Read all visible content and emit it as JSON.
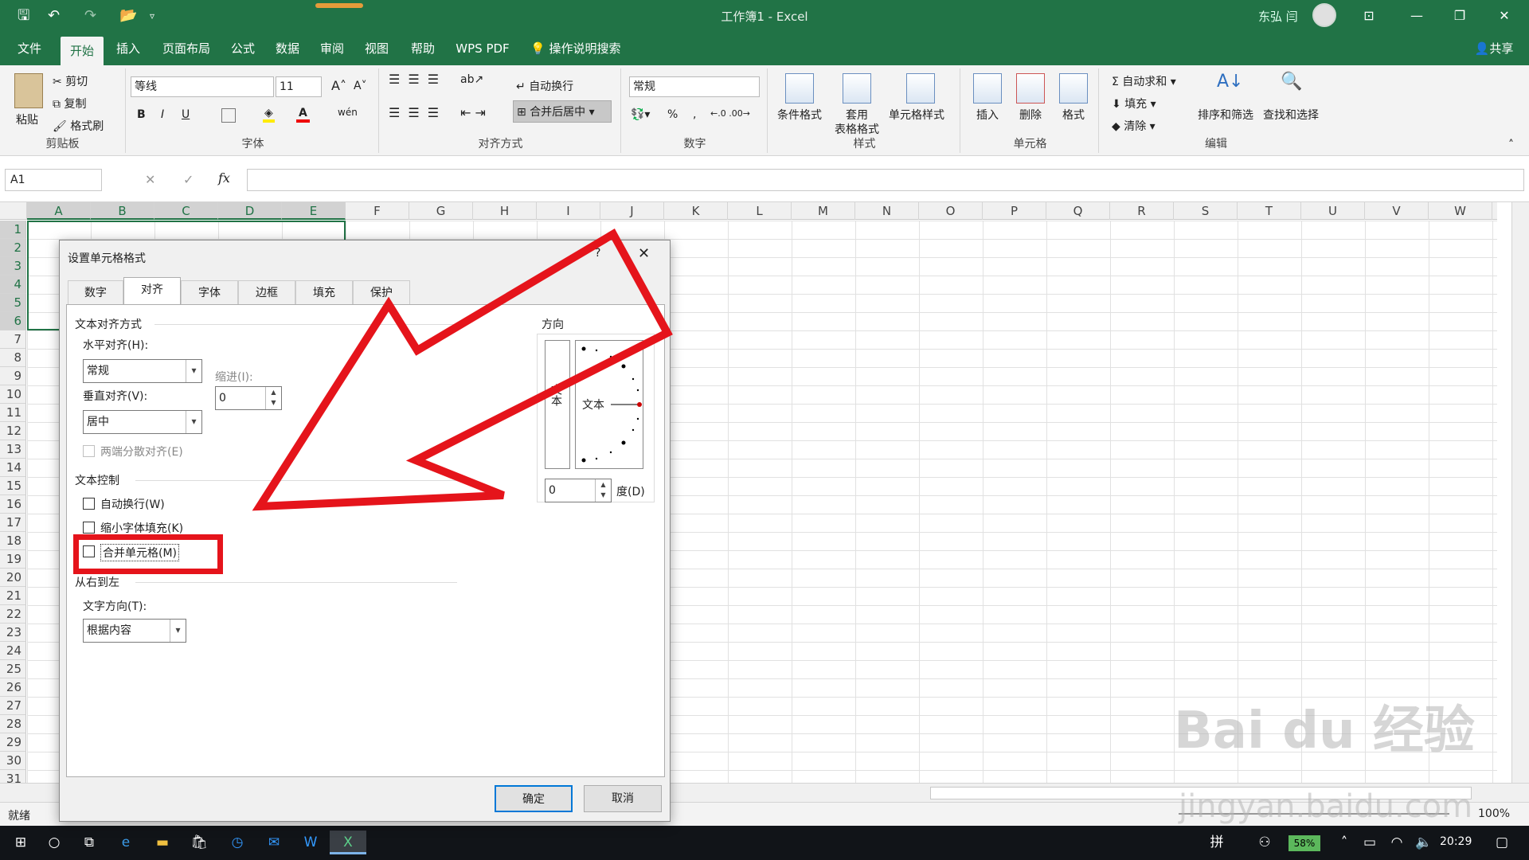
{
  "window": {
    "title": "工作簿1 - Excel",
    "user": "东弘 闫"
  },
  "menu": {
    "tabs": [
      "文件",
      "开始",
      "插入",
      "页面布局",
      "公式",
      "数据",
      "审阅",
      "视图",
      "帮助",
      "WPS PDF",
      "操作说明搜索"
    ],
    "share": "共享"
  },
  "ribbon": {
    "clipboard": {
      "paste": "粘贴",
      "cut": "剪切",
      "copy": "复制",
      "format_painter": "格式刷",
      "label": "剪贴板"
    },
    "font": {
      "name": "等线",
      "size": "11",
      "bold": "B",
      "italic": "I",
      "underline": "U",
      "label": "字体"
    },
    "align": {
      "wrap": "自动换行",
      "merge": "合并后居中",
      "label": "对齐方式"
    },
    "number": {
      "format": "常规",
      "percent": "%",
      "comma": ",",
      "label": "数字"
    },
    "styles": {
      "cond": "条件格式",
      "table1": "套用",
      "table2": "表格格式",
      "cell": "单元格样式",
      "label": "样式"
    },
    "cells": {
      "insert": "插入",
      "delete": "删除",
      "format": "格式",
      "label": "单元格"
    },
    "editing": {
      "autosum": "自动求和",
      "fill": "填充",
      "clear": "清除",
      "sort": "排序和筛选",
      "find": "查找和选择",
      "label": "编辑"
    }
  },
  "formula_bar": {
    "name_box": "A1",
    "fx": "fx"
  },
  "columns": [
    "A",
    "B",
    "C",
    "D",
    "E",
    "F",
    "G",
    "H",
    "I",
    "J",
    "K",
    "L",
    "M",
    "N",
    "O",
    "P",
    "Q",
    "R",
    "S",
    "T",
    "U",
    "V",
    "W"
  ],
  "rows": [
    "1",
    "2",
    "3",
    "4",
    "5",
    "6",
    "7",
    "8",
    "9",
    "10",
    "11",
    "12",
    "13",
    "14",
    "15",
    "16",
    "17",
    "18",
    "19",
    "20",
    "21",
    "22",
    "23",
    "24",
    "25",
    "26",
    "27",
    "28",
    "29",
    "30",
    "31"
  ],
  "status": {
    "ready": "就绪",
    "zoom": "100%"
  },
  "taskbar": {
    "time": "20:29",
    "battery": "58%",
    "ime": "拼"
  },
  "dialog": {
    "title": "设置单元格格式",
    "help": "?",
    "tabs": [
      "数字",
      "对齐",
      "字体",
      "边框",
      "填充",
      "保护"
    ],
    "text_align_section": "文本对齐方式",
    "horizontal_label": "水平对齐(H):",
    "horizontal_value": "常规",
    "indent_label": "缩进(I):",
    "indent_value": "0",
    "vertical_label": "垂直对齐(V):",
    "vertical_value": "居中",
    "distributed": "两端分散对齐(E)",
    "text_control_section": "文本控制",
    "wrap_text": "自动换行(W)",
    "shrink": "缩小字体填充(K)",
    "merge_cells": "合并单元格(M)",
    "rtl_section": "从右到左",
    "direction_label": "文字方向(T):",
    "direction_value": "根据内容",
    "orientation_label": "方向",
    "orient_vertical_text": "文本",
    "orient_text": "文本",
    "degrees_value": "0",
    "degrees_label": "度(D)",
    "ok": "确定",
    "cancel": "取消"
  },
  "watermark": {
    "brand": "Bai du 经验",
    "url": "jingyan.baidu.com"
  },
  "colors": {
    "excel_green": "#217346",
    "highlight_red": "#e5141b"
  }
}
